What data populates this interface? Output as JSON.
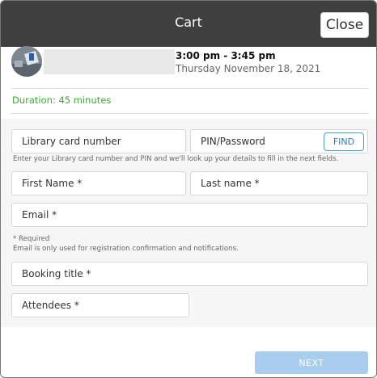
{
  "header": {
    "title": "Cart",
    "close_label": "Close"
  },
  "booking": {
    "time_range": "3:00 pm - 3:45 pm",
    "date": "Thursday November 18, 2021",
    "duration": "Duration: 45 minutes"
  },
  "form": {
    "library_card_label": "Library card number",
    "pin_label": "PIN/Password",
    "find_label": "FIND",
    "lookup_help": "Enter your Library card number and PIN and we'll look up your details to fill in the next fields.",
    "first_name_label": "First Name *",
    "last_name_label": "Last name *",
    "email_label": "Email *",
    "required_note": "* Required",
    "email_note": "Email is only used for registration confirmation and notifications.",
    "booking_title_label": "Booking title *",
    "attendees_label": "Attendees *"
  },
  "footer": {
    "next_label": "NEXT"
  },
  "colors": {
    "header_bg": "#3f3f3f",
    "duration_green": "#3aaa35",
    "next_disabled": "#a9cdec",
    "find_blue": "#2b7fbf"
  }
}
